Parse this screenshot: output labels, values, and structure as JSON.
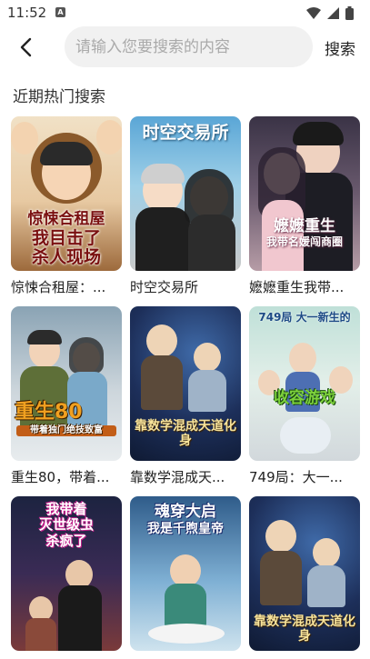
{
  "status": {
    "time": "11:52",
    "notification_icon": "A"
  },
  "header": {
    "back_icon": "chevron-left-icon",
    "search_placeholder": "请输入您要搜索的内容",
    "search_value": "",
    "search_label": "搜索"
  },
  "section": {
    "title": "近期热门搜索"
  },
  "books": [
    {
      "title": "惊悚合租屋：...",
      "cover_lines": [
        "惊悚合租屋",
        "我目击了",
        "杀人现场"
      ]
    },
    {
      "title": "时空交易所",
      "cover_lines": [
        "时空交易所"
      ]
    },
    {
      "title": "嬷嬷重生我带...",
      "cover_lines": [
        "嬷嬷重生",
        "我带名媛闯商圈"
      ]
    },
    {
      "title": "重生80，带着...",
      "cover_lines": [
        "重生80",
        "带着独门绝技致富"
      ]
    },
    {
      "title": "靠数学混成天...",
      "cover_lines": [
        "靠数学混成天道化身"
      ]
    },
    {
      "title": "749局：大一...",
      "cover_lines": [
        "749局 大一新生的",
        "收容游戏"
      ]
    },
    {
      "title": "",
      "cover_lines": [
        "我带着",
        "灭世级虫",
        "杀疯了"
      ]
    },
    {
      "title": "",
      "cover_lines": [
        "魂穿大启",
        "我是千煦皇帝"
      ]
    },
    {
      "title": "",
      "cover_lines": [
        "靠数学混成天道化身"
      ]
    }
  ]
}
